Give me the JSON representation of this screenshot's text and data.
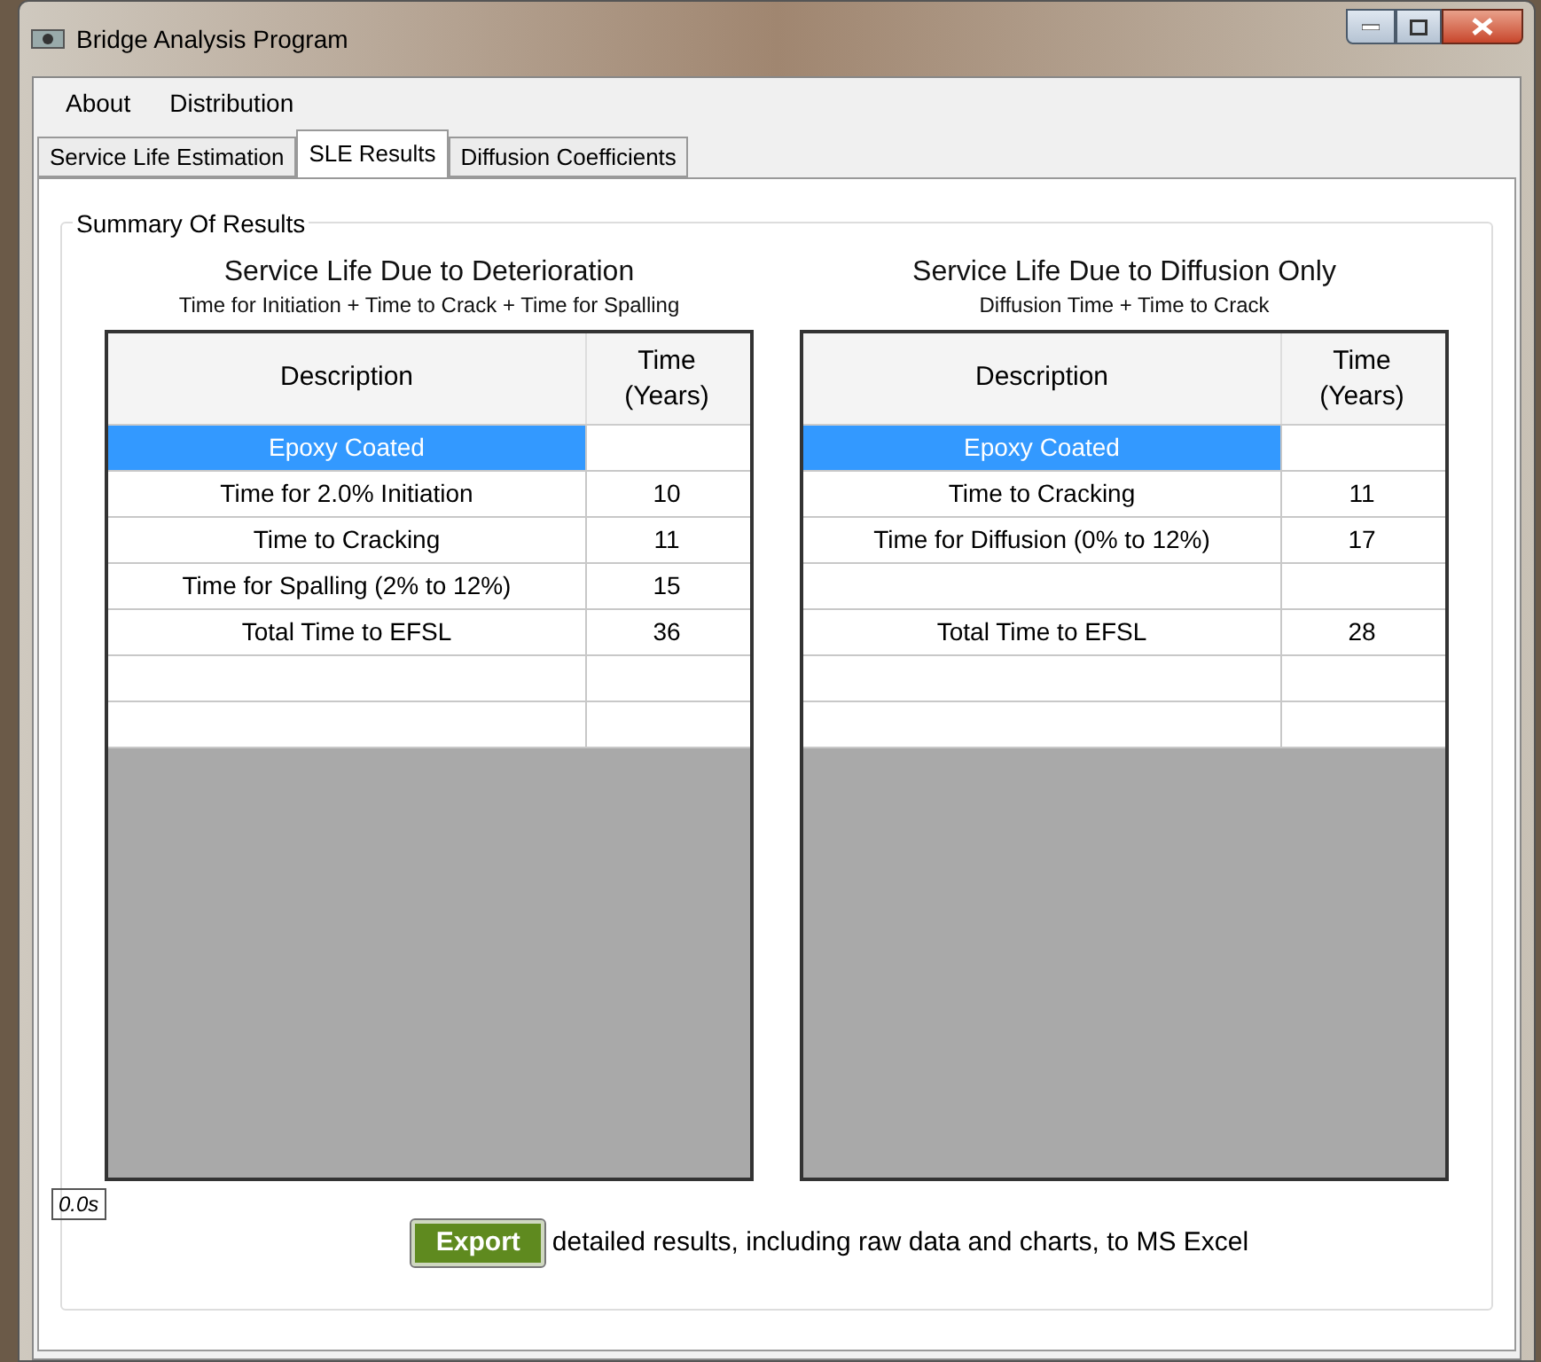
{
  "window": {
    "title": "Bridge Analysis Program"
  },
  "menu": [
    "About",
    "Distribution"
  ],
  "tabs": [
    {
      "label": "Service Life Estimation",
      "selected": false
    },
    {
      "label": "SLE Results",
      "selected": true
    },
    {
      "label": "Diffusion Coefficients",
      "selected": false
    }
  ],
  "group": {
    "title": "Summary Of Results"
  },
  "tables": [
    {
      "title": "Service Life Due to Deterioration",
      "subtitle": "Time for Initiation + Time to Crack + Time for Spalling",
      "columns": [
        "Description",
        "Time (Years)"
      ],
      "rows": [
        {
          "description": "Epoxy Coated",
          "selected": true
        },
        {
          "description": "Time for 2.0% Initiation",
          "time": "10",
          "selected": false
        },
        {
          "description": "Time to Cracking",
          "time": "11",
          "selected": false
        },
        {
          "description": "Time for Spalling (2% to 12%)",
          "time": "15",
          "selected": false
        },
        {
          "description": "Total Time to EFSL",
          "time": "36",
          "selected": false
        },
        {
          "selected": false
        },
        {
          "selected": false
        }
      ]
    },
    {
      "title": "Service Life Due to Diffusion Only",
      "subtitle": "Diffusion Time + Time to Crack",
      "columns": [
        "Description",
        "Time (Years)"
      ],
      "rows": [
        {
          "description": "Epoxy Coated",
          "selected": true
        },
        {
          "description": "Time to Cracking",
          "time": "11",
          "selected": false
        },
        {
          "description": "Time for Diffusion (0% to 12%)",
          "time": "17",
          "selected": false
        },
        {
          "selected": false
        },
        {
          "description": "Total Time to EFSL",
          "time": "28",
          "selected": false
        },
        {
          "selected": false
        },
        {
          "selected": false
        }
      ]
    }
  ],
  "timer": "0.0s",
  "export": {
    "button": "Export",
    "text": "detailed results, including raw data and charts, to MS Excel"
  }
}
